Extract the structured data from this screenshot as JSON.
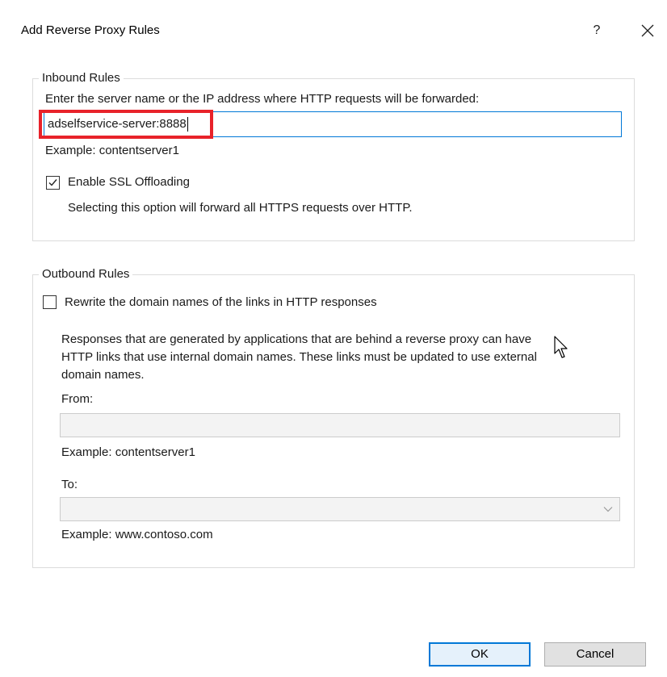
{
  "dialog": {
    "title": "Add Reverse Proxy Rules",
    "help_label": "?"
  },
  "inbound": {
    "legend": "Inbound Rules",
    "prompt": "Enter the server name or the IP address where HTTP requests will be forwarded:",
    "server_value": "adselfservice-server:8888",
    "example": "Example: contentserver1",
    "ssl_label": "Enable SSL Offloading",
    "ssl_checked": true,
    "ssl_description": "Selecting this option will forward all HTTPS requests over HTTP."
  },
  "outbound": {
    "legend": "Outbound Rules",
    "rewrite_label": "Rewrite the domain names of the links in HTTP responses",
    "rewrite_checked": false,
    "description_line1": "Responses that are generated by applications that are behind a reverse proxy can have",
    "description_line2": "HTTP links that use internal domain names. These links must be updated to use external",
    "description_line3": "domain names.",
    "from_label": "From:",
    "from_value": "",
    "from_example": "Example: contentserver1",
    "to_label": "To:",
    "to_value": "",
    "to_example": "Example: www.contoso.com"
  },
  "buttons": {
    "ok": "OK",
    "cancel": "Cancel"
  },
  "colors": {
    "highlight": "#e8222a",
    "focus": "#0078d7"
  },
  "icons": {
    "close": "close-icon",
    "check": "checkmark-icon",
    "dropdown": "chevron-down-icon",
    "cursor": "mouse-pointer-icon"
  }
}
